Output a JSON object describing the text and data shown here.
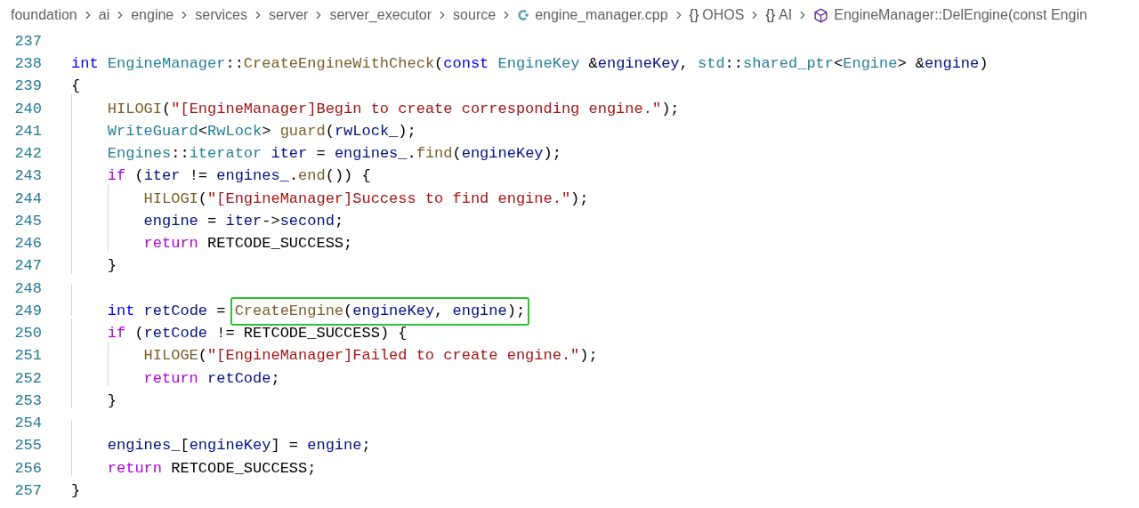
{
  "breadcrumb": [
    {
      "kind": "folder",
      "label": "foundation"
    },
    {
      "kind": "folder",
      "label": "ai"
    },
    {
      "kind": "folder",
      "label": "engine"
    },
    {
      "kind": "folder",
      "label": "services"
    },
    {
      "kind": "folder",
      "label": "server"
    },
    {
      "kind": "folder",
      "label": "server_executor"
    },
    {
      "kind": "folder",
      "label": "source"
    },
    {
      "kind": "cpp-file",
      "label": "engine_manager.cpp"
    },
    {
      "kind": "namespace",
      "icon_text": "{}",
      "label": "OHOS"
    },
    {
      "kind": "namespace",
      "icon_text": "{}",
      "label": "AI"
    },
    {
      "kind": "method",
      "label": "EngineManager::DelEngine(const Engin"
    }
  ],
  "code_lines": [
    {
      "number": "237"
    },
    {
      "number": "238",
      "tokens": [
        {
          "text": "int",
          "kind": "keyword"
        },
        {
          "text": " EngineManager",
          "kind": "type"
        },
        {
          "text": "::",
          "kind": "plain"
        },
        {
          "text": "CreateEngineWithCheck",
          "kind": "function"
        },
        {
          "text": "(",
          "kind": "plain"
        },
        {
          "text": "const",
          "kind": "keyword"
        },
        {
          "text": " EngineKey",
          "kind": "type"
        },
        {
          "text": " &",
          "kind": "plain"
        },
        {
          "text": "engineKey",
          "kind": "variable"
        },
        {
          "text": ", ",
          "kind": "plain"
        },
        {
          "text": "std",
          "kind": "type"
        },
        {
          "text": "::",
          "kind": "plain"
        },
        {
          "text": "shared_ptr",
          "kind": "type"
        },
        {
          "text": "<",
          "kind": "plain"
        },
        {
          "text": "Engine",
          "kind": "type"
        },
        {
          "text": "> &",
          "kind": "plain"
        },
        {
          "text": "engine",
          "kind": "variable"
        },
        {
          "text": ")",
          "kind": "plain"
        }
      ]
    },
    {
      "number": "239",
      "tokens": [
        {
          "text": "{",
          "kind": "plain"
        }
      ]
    },
    {
      "number": "240",
      "tokens": [
        {
          "text": "    HILOGI",
          "kind": "function"
        },
        {
          "text": "(",
          "kind": "plain"
        },
        {
          "text": "\"[EngineManager]Begin to create corresponding engine.\"",
          "kind": "string"
        },
        {
          "text": ");",
          "kind": "plain"
        }
      ]
    },
    {
      "number": "241",
      "tokens": [
        {
          "text": "    WriteGuard",
          "kind": "type"
        },
        {
          "text": "<",
          "kind": "plain"
        },
        {
          "text": "RwLock",
          "kind": "type"
        },
        {
          "text": "> ",
          "kind": "plain"
        },
        {
          "text": "guard",
          "kind": "function"
        },
        {
          "text": "(",
          "kind": "plain"
        },
        {
          "text": "rwLock_",
          "kind": "variable"
        },
        {
          "text": ");",
          "kind": "plain"
        }
      ]
    },
    {
      "number": "242",
      "tokens": [
        {
          "text": "    Engines",
          "kind": "type"
        },
        {
          "text": "::",
          "kind": "plain"
        },
        {
          "text": "iterator",
          "kind": "type"
        },
        {
          "text": " iter",
          "kind": "variable"
        },
        {
          "text": " = ",
          "kind": "plain"
        },
        {
          "text": "engines_",
          "kind": "variable"
        },
        {
          "text": ".",
          "kind": "plain"
        },
        {
          "text": "find",
          "kind": "function"
        },
        {
          "text": "(",
          "kind": "plain"
        },
        {
          "text": "engineKey",
          "kind": "variable"
        },
        {
          "text": ");",
          "kind": "plain"
        }
      ]
    },
    {
      "number": "243",
      "tokens": [
        {
          "text": "    if",
          "kind": "control"
        },
        {
          "text": " (",
          "kind": "plain"
        },
        {
          "text": "iter",
          "kind": "variable"
        },
        {
          "text": " != ",
          "kind": "plain"
        },
        {
          "text": "engines_",
          "kind": "variable"
        },
        {
          "text": ".",
          "kind": "plain"
        },
        {
          "text": "end",
          "kind": "function"
        },
        {
          "text": "()) {",
          "kind": "plain"
        }
      ]
    },
    {
      "number": "244",
      "tokens": [
        {
          "text": "        HILOGI",
          "kind": "function"
        },
        {
          "text": "(",
          "kind": "plain"
        },
        {
          "text": "\"[EngineManager]Success to find engine.\"",
          "kind": "string"
        },
        {
          "text": ");",
          "kind": "plain"
        }
      ]
    },
    {
      "number": "245",
      "tokens": [
        {
          "text": "        engine",
          "kind": "variable"
        },
        {
          "text": " = ",
          "kind": "plain"
        },
        {
          "text": "iter",
          "kind": "variable"
        },
        {
          "text": "->",
          "kind": "plain"
        },
        {
          "text": "second",
          "kind": "variable"
        },
        {
          "text": ";",
          "kind": "plain"
        }
      ]
    },
    {
      "number": "246",
      "tokens": [
        {
          "text": "        return",
          "kind": "control"
        },
        {
          "text": " RETCODE_SUCCESS;",
          "kind": "plain"
        }
      ]
    },
    {
      "number": "247",
      "tokens": [
        {
          "text": "    }",
          "kind": "plain"
        }
      ]
    },
    {
      "number": "248"
    },
    {
      "number": "249",
      "tokens": [
        {
          "text": "    int",
          "kind": "keyword"
        },
        {
          "text": " retCode",
          "kind": "variable"
        },
        {
          "text": " = ",
          "kind": "plain"
        }
      ],
      "boxed_tokens": [
        {
          "text": "CreateEngine",
          "kind": "function"
        },
        {
          "text": "(",
          "kind": "plain"
        },
        {
          "text": "engineKey",
          "kind": "variable"
        },
        {
          "text": ", ",
          "kind": "plain"
        },
        {
          "text": "engine",
          "kind": "variable"
        },
        {
          "text": ");",
          "kind": "plain"
        }
      ]
    },
    {
      "number": "250",
      "tokens": [
        {
          "text": "    if",
          "kind": "control"
        },
        {
          "text": " (",
          "kind": "plain"
        },
        {
          "text": "retCode",
          "kind": "variable"
        },
        {
          "text": " != RETCODE_SUCCESS) {",
          "kind": "plain"
        }
      ]
    },
    {
      "number": "251",
      "tokens": [
        {
          "text": "        HILOGE",
          "kind": "function"
        },
        {
          "text": "(",
          "kind": "plain"
        },
        {
          "text": "\"[EngineManager]Failed to create engine.\"",
          "kind": "string"
        },
        {
          "text": ");",
          "kind": "plain"
        }
      ]
    },
    {
      "number": "252",
      "tokens": [
        {
          "text": "        return",
          "kind": "control"
        },
        {
          "text": " retCode",
          "kind": "variable"
        },
        {
          "text": ";",
          "kind": "plain"
        }
      ]
    },
    {
      "number": "253",
      "tokens": [
        {
          "text": "    }",
          "kind": "plain"
        }
      ]
    },
    {
      "number": "254"
    },
    {
      "number": "255",
      "tokens": [
        {
          "text": "    engines_",
          "kind": "variable"
        },
        {
          "text": "[",
          "kind": "plain"
        },
        {
          "text": "engineKey",
          "kind": "variable"
        },
        {
          "text": "] = ",
          "kind": "plain"
        },
        {
          "text": "engine",
          "kind": "variable"
        },
        {
          "text": ";",
          "kind": "plain"
        }
      ]
    },
    {
      "number": "256",
      "tokens": [
        {
          "text": "    return",
          "kind": "control"
        },
        {
          "text": " RETCODE_SUCCESS;",
          "kind": "plain"
        }
      ]
    },
    {
      "number": "257",
      "tokens": [
        {
          "text": "}",
          "kind": "plain"
        }
      ]
    }
  ]
}
